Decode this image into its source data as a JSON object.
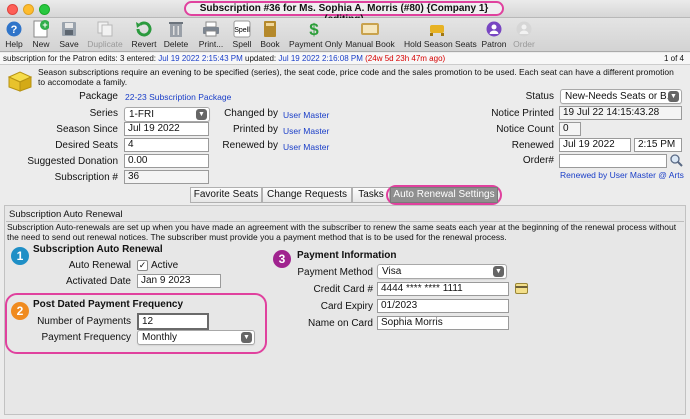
{
  "window": {
    "title": "Subscription #36 for Ms. Sophia A. Morris (#80) {Company 1} (editing)"
  },
  "toolbar": [
    {
      "label": "Help",
      "icon": "question-icon",
      "enabled": true
    },
    {
      "label": "New",
      "icon": "new-document-icon",
      "enabled": true
    },
    {
      "label": "Save",
      "icon": "save-icon",
      "enabled": true
    },
    {
      "label": "Duplicate",
      "icon": "duplicate-icon",
      "enabled": false
    },
    {
      "label": "Revert",
      "icon": "revert-icon",
      "enabled": true
    },
    {
      "label": "Delete",
      "icon": "trash-icon",
      "enabled": true
    },
    {
      "label": "Print...",
      "icon": "printer-icon",
      "enabled": true
    },
    {
      "label": "Spell",
      "icon": "spell-check-icon",
      "enabled": true
    },
    {
      "label": "Book",
      "icon": "book-icon",
      "enabled": true
    },
    {
      "label": "Payment Only",
      "icon": "dollar-icon",
      "enabled": true
    },
    {
      "label": "Manual Book",
      "icon": "manual-book-icon",
      "enabled": true
    },
    {
      "label": "Hold Season Seats",
      "icon": "seats-icon",
      "enabled": true
    },
    {
      "label": "Patron",
      "icon": "patron-icon",
      "enabled": true
    },
    {
      "label": "Order",
      "icon": "order-icon",
      "enabled": false
    }
  ],
  "infobar": {
    "prefix": "subscription for the Patron edits:",
    "edits": "3",
    "entered_label": "entered:",
    "entered": "Jul 19 2022 2:15:43 PM",
    "updated_label": "updated:",
    "updated": "Jul 19 2022 2:16:08 PM",
    "age": "(24w 5d 23h 47m ago)",
    "pager": "1 of 4"
  },
  "notice": "Season subscriptions require an evening to be specified (series), the seat code, price code and the sales promotion to be used.  Each seat can have a different promotion to accomodate a family.",
  "form": {
    "package_label": "Package",
    "package_value": "22-23 Subscription Package",
    "series_label": "Series",
    "series_value": "1-FRI",
    "season_since_label": "Season Since",
    "season_since_value": "Jul 19 2022",
    "desired_seats_label": "Desired Seats",
    "desired_seats_value": "4",
    "suggested_donation_label": "Suggested Donation",
    "suggested_donation_value": "0.00",
    "subscription_no_label": "Subscription #",
    "subscription_no_value": "36",
    "changed_by_label": "Changed by",
    "changed_by_value": "User Master",
    "printed_by_label": "Printed by",
    "printed_by_value": "User Master",
    "renewed_by_label": "Renewed by",
    "renewed_by_value": "User Master",
    "status_label": "Status",
    "status_value": "New-Needs Seats or B...",
    "notice_printed_label": "Notice Printed",
    "notice_printed_value": "19 Jul 22  14:15:43.28",
    "notice_count_label": "Notice Count",
    "notice_count_value": "0",
    "renewed_label": "Renewed",
    "renewed_date": "Jul 19 2022",
    "renewed_time": "2:15 PM",
    "order_label": "Order#",
    "order_value": "",
    "renewed_note": "Renewed by User Master @ Arts Ma"
  },
  "tabs": [
    "Favorite Seats",
    "Change Requests",
    "Tasks",
    "Auto Renewal Settings"
  ],
  "active_tab": "Auto Renewal Settings",
  "panel": {
    "title": "Subscription Auto Renewal",
    "desc": "Subscription Auto-renewals are set up when you have made an agreement with the subscriber to renew the same seats each year at the beginning of the renewal process without the need to send out renewal notices.  The subscriber must provide you a payment method that is to be used for the renewal process.",
    "sec1": {
      "badge": "1",
      "title": "Subscription Auto Renewal",
      "auto_renewal_label": "Auto Renewal",
      "active_label": "Active",
      "active_checked": true,
      "activated_date_label": "Activated Date",
      "activated_date_value": "Jan 9 2023"
    },
    "sec2": {
      "badge": "2",
      "title": "Post Dated Payment Frequency",
      "num_payments_label": "Number of Payments",
      "num_payments_value": "12",
      "frequency_label": "Payment Frequency",
      "frequency_value": "Monthly"
    },
    "sec3": {
      "badge": "3",
      "title": "Payment Information",
      "method_label": "Payment Method",
      "method_value": "Visa",
      "card_label": "Credit Card #",
      "card_value": "4444 **** **** 1111",
      "expiry_label": "Card Expiry",
      "expiry_value": "01/2023",
      "name_label": "Name on Card",
      "name_value": "Sophia Morris"
    }
  },
  "colors": {
    "highlight": "#e0419e",
    "link": "#1a3ec8",
    "badge1": "#1f8fc6",
    "badge2": "#f08b1f",
    "badge3": "#a0238f",
    "tab_active": "#8f8f8f"
  }
}
